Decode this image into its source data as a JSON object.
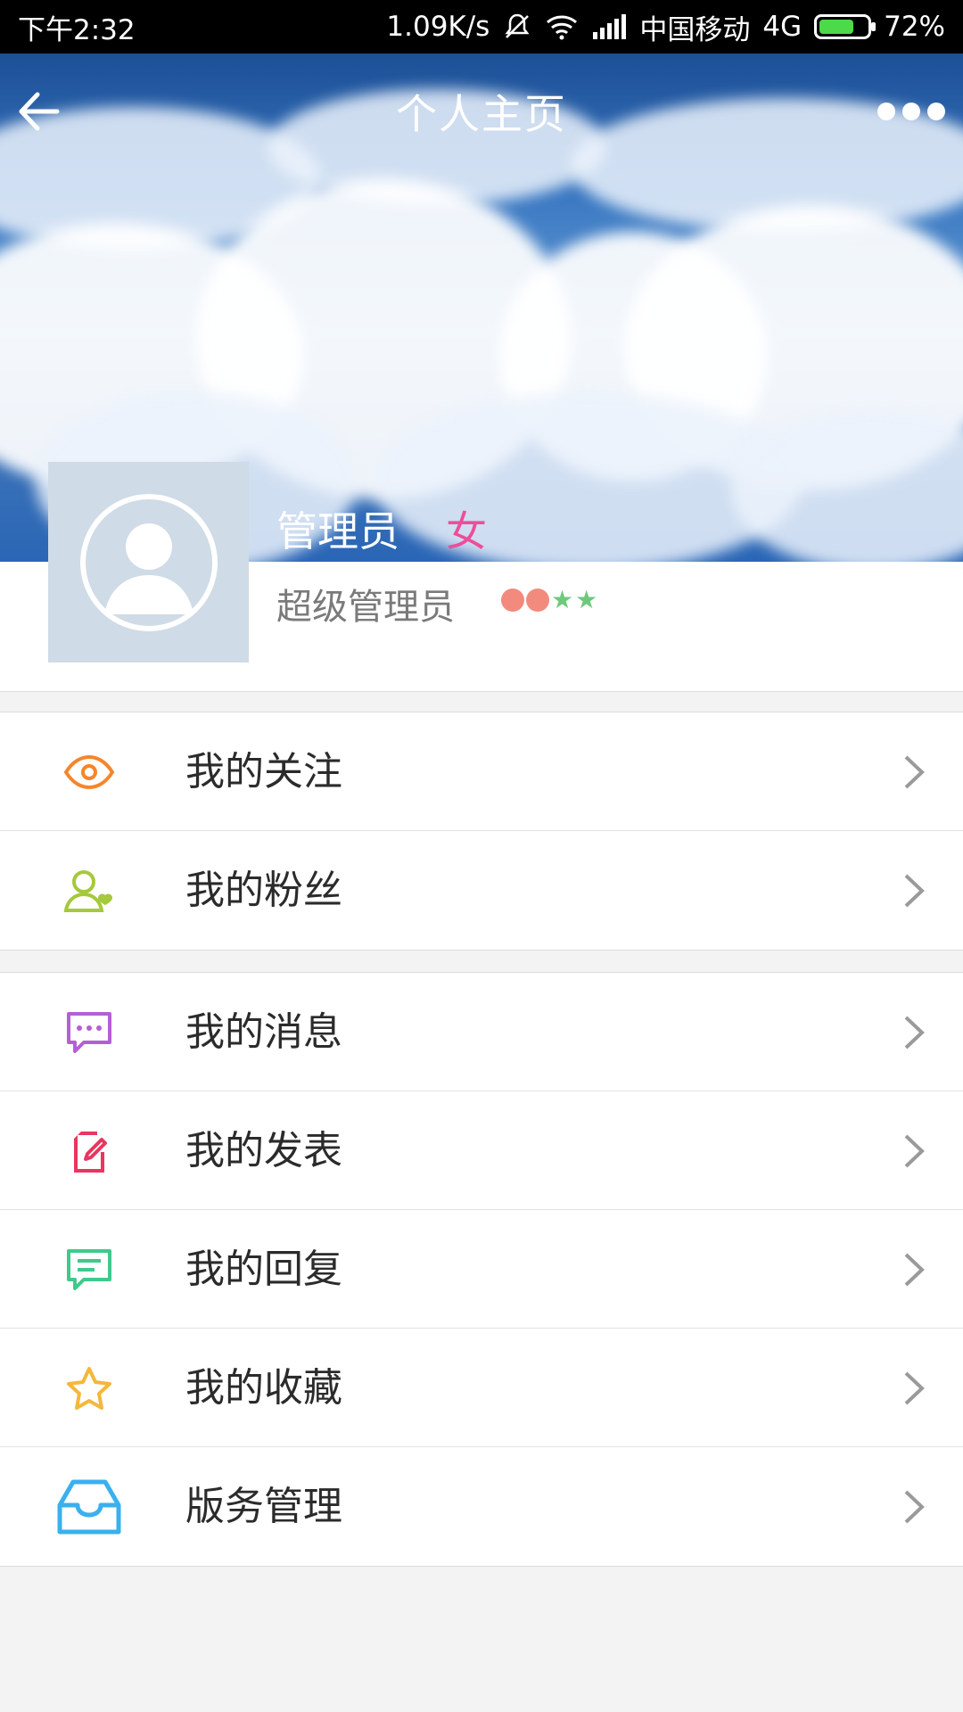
{
  "status_bar": {
    "time": "下午2:32",
    "network_speed": "1.09K/s",
    "carrier": "中国移动",
    "network_type": "4G",
    "battery": "72%",
    "battery_level": 0.72
  },
  "header": {
    "title": "个人主页"
  },
  "profile": {
    "name": "管理员",
    "gender": "女",
    "role": "超级管理员",
    "level_icons": [
      "dot",
      "dot",
      "star",
      "star"
    ]
  },
  "colors": {
    "gender_pink": "#ee4d9a",
    "eye_orange": "#f5862a",
    "fans_green": "#a5c93c",
    "message_purple": "#b45fd6",
    "post_red": "#e8365f",
    "reply_green": "#3fc98b",
    "star_yellow": "#f5b73b",
    "manage_blue": "#3ab0ee"
  },
  "menu": {
    "group1": [
      {
        "label": "我的关注",
        "icon": "eye-icon"
      },
      {
        "label": "我的粉丝",
        "icon": "fans-icon"
      }
    ],
    "group2": [
      {
        "label": "我的消息",
        "icon": "message-icon"
      },
      {
        "label": "我的发表",
        "icon": "edit-icon"
      },
      {
        "label": "我的回复",
        "icon": "reply-icon"
      },
      {
        "label": "我的收藏",
        "icon": "star-icon"
      },
      {
        "label": "版务管理",
        "icon": "inbox-icon"
      }
    ]
  }
}
